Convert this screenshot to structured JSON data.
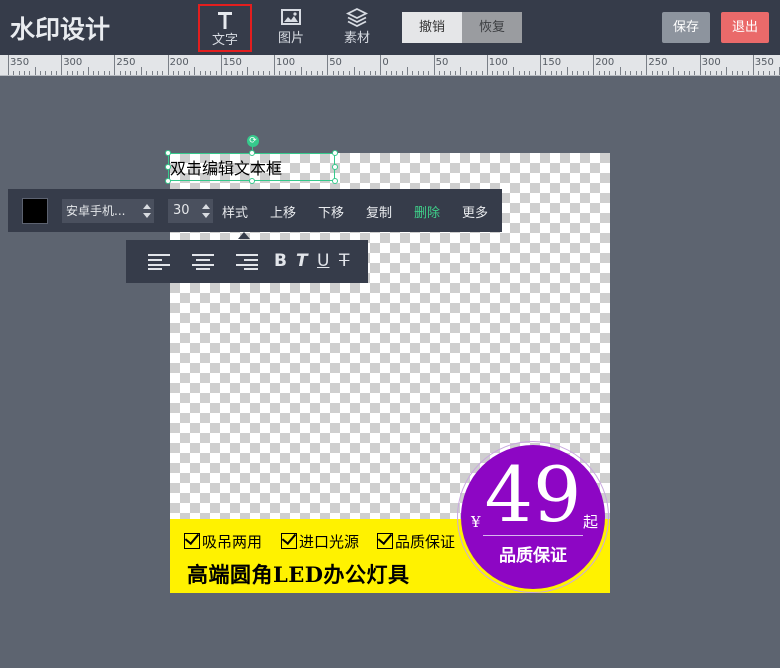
{
  "app": {
    "logo": "水印设计"
  },
  "toolbar": {
    "tools": [
      {
        "label": "文字",
        "icon": "text-icon",
        "active": true
      },
      {
        "label": "图片",
        "icon": "image-icon",
        "active": false
      },
      {
        "label": "素材",
        "icon": "layers-icon",
        "active": false
      }
    ],
    "undo_label": "撤销",
    "redo_label": "恢复",
    "save_label": "保存",
    "exit_label": "退出"
  },
  "ruler": {
    "labels": [
      "350",
      "300",
      "250",
      "200",
      "150",
      "100",
      "50",
      "0",
      "50",
      "100",
      "150",
      "200",
      "250",
      "300",
      "350"
    ]
  },
  "selected_text": {
    "value": "双击编辑文本框"
  },
  "text_toolbar": {
    "color": "#000000",
    "font": "安卓手机...",
    "size": "30",
    "style_label": "样式",
    "move_up_label": "上移",
    "move_down_label": "下移",
    "copy_label": "复制",
    "delete_label": "删除",
    "more_label": "更多"
  },
  "format_toolbar": {
    "align_icons": [
      "align-left-icon",
      "align-center-icon",
      "align-right-icon"
    ],
    "bold": "B",
    "italic": "T",
    "underline": "U",
    "strike": "T"
  },
  "poster": {
    "features": [
      "吸吊两用",
      "进口光源",
      "品质保证"
    ],
    "title": "高端圆角LED办公灯具",
    "band_color": "#fff200",
    "badge": {
      "currency": "¥",
      "price": "49",
      "suffix": "起",
      "guarantee": "品质保证",
      "color": "#8d06c4"
    }
  }
}
